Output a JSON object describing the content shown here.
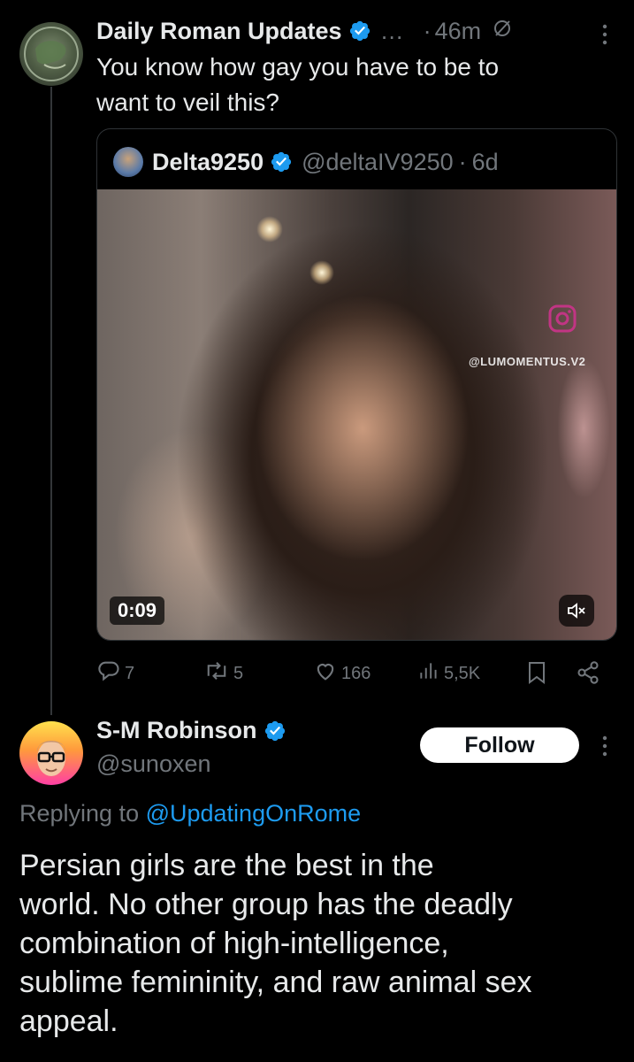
{
  "parent_tweet": {
    "author_name": "Daily Roman Updates",
    "ellipsis": "…",
    "separator": "·",
    "time": "46m",
    "text_line1": "You know how gay you have to be to",
    "text_line2": "want to veil this?",
    "quoted": {
      "author_name": "Delta9250",
      "handle": "@deltaIV9250",
      "separator": "·",
      "time": "6d",
      "video": {
        "duration": "0:09",
        "watermark": "@LUMOMENTUS.V2"
      }
    },
    "actions": {
      "replies": "7",
      "retweets": "5",
      "likes": "166",
      "views": "5,5K"
    }
  },
  "reply_tweet": {
    "author_name": "S-M Robinson",
    "handle": "@sunoxen",
    "follow_label": "Follow",
    "replying_prefix": "Replying to ",
    "replying_handle": "@UpdatingOnRome",
    "text_lines": [
      "Persian girls are the best in the",
      "world. No other group has the deadly",
      "combination of high-intelligence,",
      "sublime femininity, and raw animal sex",
      "appeal."
    ]
  },
  "colors": {
    "background": "#000000",
    "primary_text": "#e7e9ea",
    "secondary_text": "#71767b",
    "verified_blue": "#1d9bf0",
    "link": "#1d9bf0"
  },
  "icons": [
    "verified-badge-icon",
    "grok-slash-icon",
    "more-options-icon",
    "reply-icon",
    "retweet-icon",
    "like-icon",
    "views-icon",
    "bookmark-icon",
    "share-icon",
    "muted-speaker-icon",
    "instagram-icon"
  ]
}
